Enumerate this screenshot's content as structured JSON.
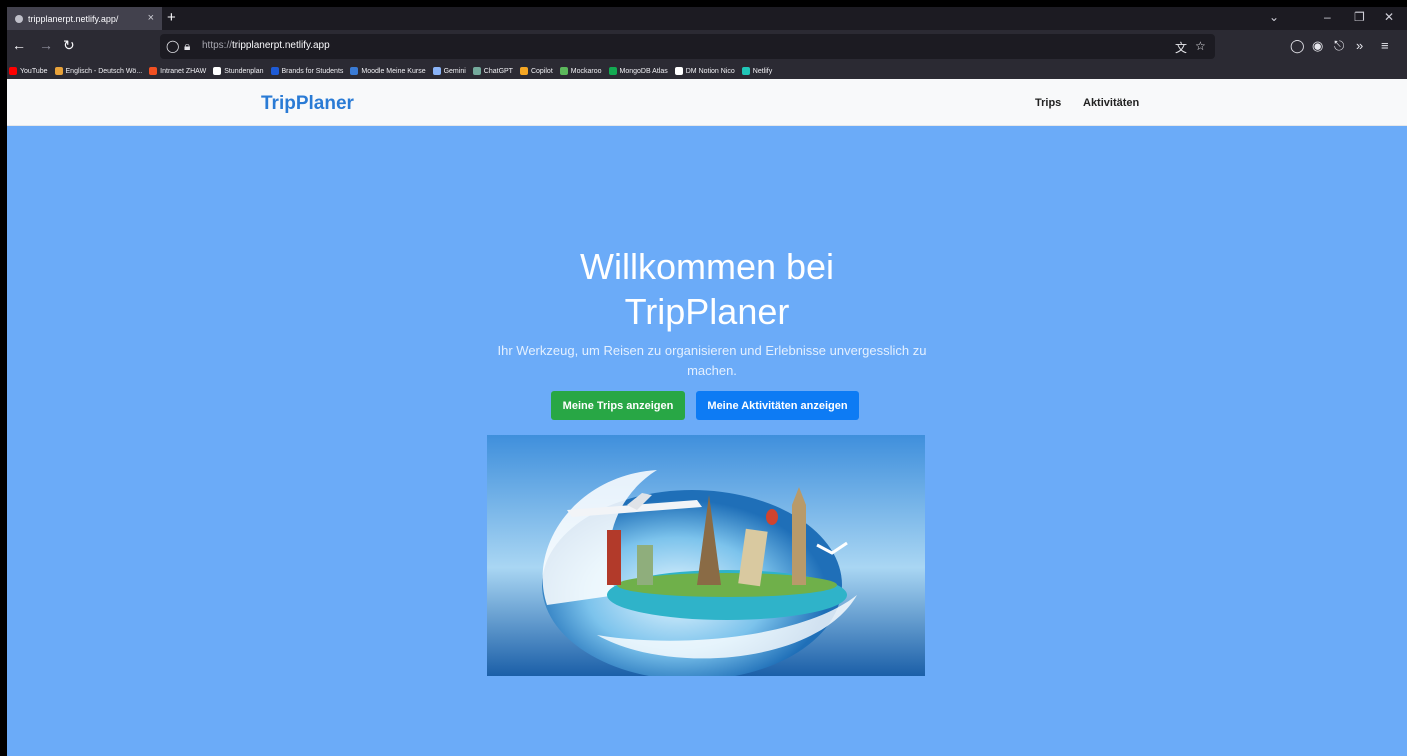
{
  "browser": {
    "tab_title": "tripplanerpt.netlify.app/",
    "tab_close": "×",
    "new_tab": "+",
    "url_protocol": "https://",
    "url_host": "tripplanerpt.netlify.app",
    "icons": [
      "back-icon",
      "forward-icon",
      "reload-icon",
      "shield-icon",
      "lock-icon",
      "translate-icon",
      "star-icon",
      "pocket-icon",
      "account-icon",
      "extensions-icon",
      "overflow-icon",
      "menu-icon"
    ]
  },
  "bookmarks": [
    {
      "label": "YouTube",
      "color": "#ff0000"
    },
    {
      "label": "Englisch - Deutsch Wö...",
      "color": "#e8a23a"
    },
    {
      "label": "Intranet ZHAW",
      "color": "#f25022"
    },
    {
      "label": "Stundenplan",
      "color": "#ffffff"
    },
    {
      "label": "Brands for Students",
      "color": "#1e5bd6"
    },
    {
      "label": "Moodle Meine Kurse",
      "color": "#3a7bd5"
    },
    {
      "label": "Gemini",
      "color": "#8ab4f8"
    },
    {
      "label": "ChatGPT",
      "color": "#74aa9c"
    },
    {
      "label": "Copilot",
      "color": "#f5a623"
    },
    {
      "label": "Mockaroo",
      "color": "#5cb85c"
    },
    {
      "label": "MongoDB Atlas",
      "color": "#13aa52"
    },
    {
      "label": "DM Notion Nico",
      "color": "#ffffff"
    },
    {
      "label": "Netlify",
      "color": "#20c6b7"
    }
  ],
  "site": {
    "brand": "TripPlaner",
    "nav": [
      "Trips",
      "Aktivitäten"
    ],
    "hero_title_line1": "Willkommen bei",
    "hero_title_line2": "TripPlaner",
    "hero_subtitle": "Ihr Werkzeug, um Reisen zu organisieren und Erlebnisse unvergesslich zu machen.",
    "btn_trips": "Meine Trips anzeigen",
    "btn_activities": "Meine Aktivitäten anzeigen",
    "colors": {
      "background": "#6babf8",
      "brand": "#2a7bd5",
      "green": "#28a745",
      "blue": "#0d7bf4"
    }
  }
}
